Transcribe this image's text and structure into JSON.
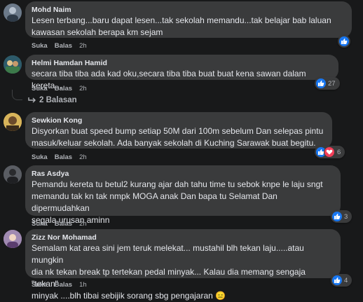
{
  "comments": [
    {
      "author": "Mohd Naim",
      "text": "Lesen terbang...baru dapat lesen...tak sekolah memandu...tak belajar bab laluan\nkawasan sekolah berapa km sejam",
      "like_label": "Suka",
      "reply_label": "Balas",
      "time": "2h",
      "reactions": [
        "like"
      ],
      "reaction_count": "",
      "avatar_color": "#6c7a8a"
    },
    {
      "author": "Helmi Hamdan Hamid",
      "text": "secara tiba tiba ada kad oku,secara tiba tiba buat buat kena sawan dalam kereta...",
      "like_label": "Suka",
      "reply_label": "Balas",
      "time": "2h",
      "reactions": [
        "like"
      ],
      "reaction_count": "27",
      "avatar_color": "#3d6b4f",
      "replies_label": "2 Balasan"
    },
    {
      "author": "Sewkion Kong",
      "text": "Disyorkan buat speed bump setiap 50M dari 100m sebelum Dan selepas pintu\nmasuk/keluar sekolah. Ada banyak sekolah di Kuching Sarawak buat begitu.",
      "like_label": "Suka",
      "reply_label": "Balas",
      "time": "2h",
      "reactions": [
        "like",
        "love"
      ],
      "reaction_count": "6",
      "avatar_color": "#c9a24a"
    },
    {
      "author": "Ras Asdya",
      "text": "Pemandu kereta tu betul2 kurang ajar dah tahu time tu sebok knpe le laju sngt\nmemandu tak kn tak nmpk MOGA anak Dan bapa tu Selamat Dan dipermudahkan\nsegala urusan aminn",
      "like_label": "Suka",
      "reply_label": "Balas",
      "time": "2h",
      "reactions": [
        "like"
      ],
      "reaction_count": "3",
      "avatar_color": "#4a4d52"
    },
    {
      "author": "Zizz Nor Mohamad",
      "text": "Semalam kat area sini jem teruk melekat... mustahil blh tekan laju.....atau mungkin\ndia nk tekan break tp tertekan pedal minyak... Kalau dia memang sengaja \"tekan\"\nminyak ....blh tibai sebijik sorang sbg pengajaran 😑",
      "like_label": "Suka",
      "reply_label": "Balas",
      "time": "1h",
      "reactions": [
        "like"
      ],
      "reaction_count": "4",
      "avatar_color": "#8a6f9e"
    }
  ]
}
